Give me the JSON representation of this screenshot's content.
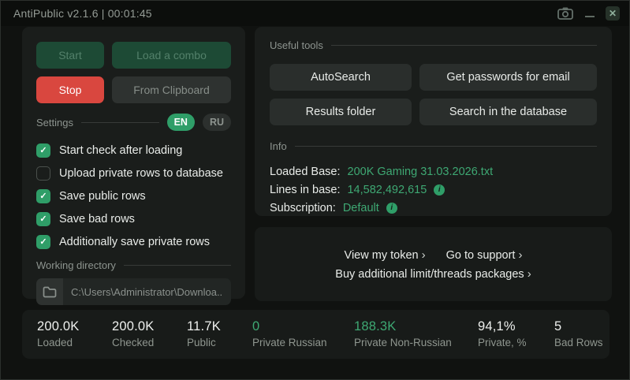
{
  "window": {
    "title": "AntiPublic v2.1.6 | 00:01:45"
  },
  "icons": {
    "check": "✓",
    "close": "✕",
    "chevron": "›",
    "info": "i"
  },
  "colors": {
    "accent_green": "#2f9e68",
    "value_green": "#3ea873",
    "stop_red": "#d9473f",
    "panel_bg": "#1a1d1b",
    "window_bg": "#101210"
  },
  "left_panel": {
    "buttons": {
      "start": "Start",
      "load_combo": "Load a combo",
      "stop": "Stop",
      "from_clipboard": "From Clipboard"
    },
    "settings": {
      "label": "Settings",
      "languages": [
        {
          "label": "EN",
          "active": true
        },
        {
          "label": "RU",
          "active": false
        }
      ],
      "checkboxes": [
        {
          "label": "Start check after loading",
          "checked": true
        },
        {
          "label": "Upload private rows to database",
          "checked": false
        },
        {
          "label": "Save public rows",
          "checked": true
        },
        {
          "label": "Save bad rows",
          "checked": true
        },
        {
          "label": "Additionally save private rows",
          "checked": true
        }
      ]
    },
    "working_directory": {
      "label": "Working directory",
      "value": "C:\\Users\\Administrator\\Downloa..."
    }
  },
  "tools": {
    "label": "Useful tools",
    "buttons": [
      "AutoSearch",
      "Get passwords for email",
      "Results folder",
      "Search in the database"
    ]
  },
  "info": {
    "label": "Info",
    "rows": [
      {
        "label": "Loaded Base:",
        "value": "200K Gaming 31.03.2026.txt",
        "has_info": false
      },
      {
        "label": "Lines in base:",
        "value": "14,582,492,615",
        "has_info": true
      },
      {
        "label": "Subscription:",
        "value": "Default",
        "has_info": true
      }
    ]
  },
  "links": {
    "view_token": "View my token",
    "support": "Go to support",
    "buy": "Buy additional limit/threads packages"
  },
  "stats": [
    {
      "value": "200.0K",
      "label": "Loaded",
      "green": false
    },
    {
      "value": "200.0K",
      "label": "Checked",
      "green": false
    },
    {
      "value": "11.7K",
      "label": "Public",
      "green": false
    },
    {
      "value": "0",
      "label": "Private Russian",
      "green": true
    },
    {
      "value": "188.3K",
      "label": "Private Non-Russian",
      "green": true
    },
    {
      "value": "94,1%",
      "label": "Private, %",
      "green": false
    },
    {
      "value": "5",
      "label": "Bad Rows",
      "green": false
    }
  ]
}
